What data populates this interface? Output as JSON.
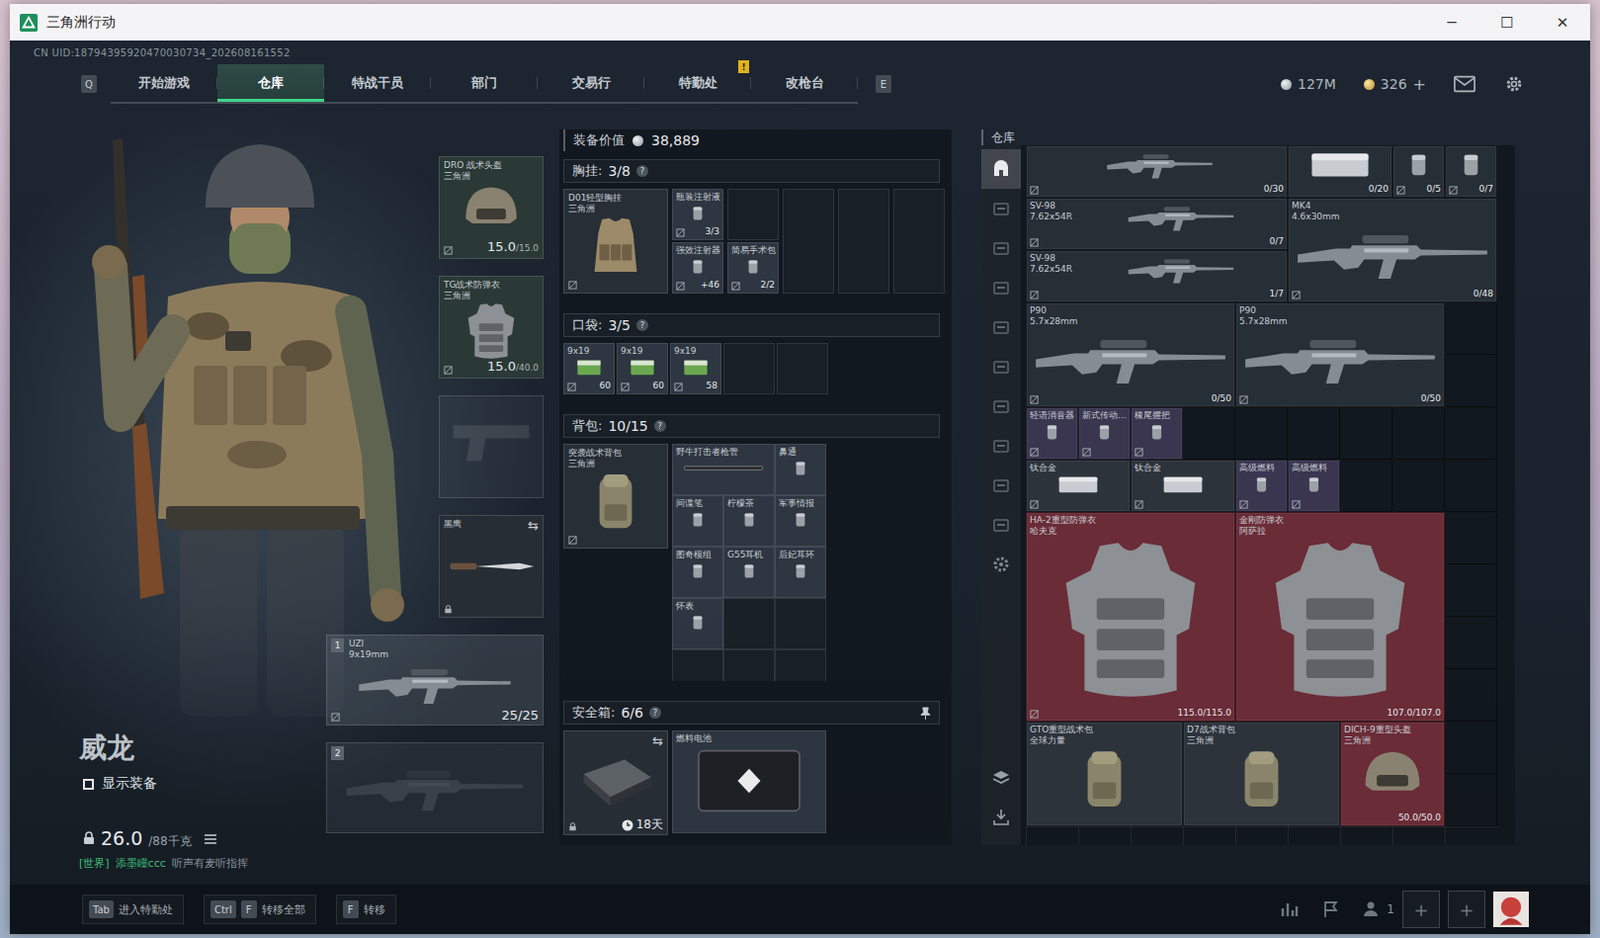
{
  "window": {
    "title": "三角洲行动",
    "controls": [
      "─",
      "☐",
      "✕"
    ]
  },
  "uid": "CN UID:18794395920470030734_202608161552",
  "nav": {
    "prev_key": "Q",
    "next_key": "E",
    "tabs": [
      {
        "label": "开始游戏",
        "selected": false
      },
      {
        "label": "仓库",
        "selected": true
      },
      {
        "label": "特战干员",
        "selected": false
      },
      {
        "label": "部门",
        "selected": false
      },
      {
        "label": "交易行",
        "selected": false
      },
      {
        "label": "特勤处",
        "selected": false,
        "badge": "!"
      },
      {
        "label": "改枪台",
        "selected": false
      }
    ]
  },
  "currency": [
    {
      "kind": "silver",
      "amount": "127M"
    },
    {
      "kind": "gold",
      "amount": "326",
      "add": "+"
    }
  ],
  "operator": {
    "name": "威龙",
    "show_gear": {
      "label": "显示装备",
      "checked": false
    },
    "weight": {
      "value": "26.0",
      "max": "/88千克"
    },
    "chat": {
      "channel": "[世界]",
      "user": "添墨瞳ccc",
      "text": "听声有麦听指挥"
    }
  },
  "equipment": [
    {
      "kind": "helmet",
      "filled": true,
      "name": "DRO 战术头盔",
      "sub": "三角洲",
      "reading": "15.0",
      "max": "/15.0",
      "marked": true,
      "color": "#2a3936"
    },
    {
      "kind": "armor",
      "filled": true,
      "name": "TG战术防弹衣",
      "sub": "三角洲",
      "reading": "15.0",
      "max": "/40.0",
      "marked": true,
      "color": "#2a3936"
    },
    {
      "kind": "pistol",
      "filled": false
    },
    {
      "kind": "melee",
      "filled": true,
      "name": "黑鹰",
      "swap": "⇆",
      "locked": true,
      "color": "#262d34"
    }
  ],
  "weapons": [
    {
      "slot": "1",
      "kind": "gun",
      "filled": true,
      "name": "UZI",
      "sub": "9x19mm",
      "ammo": "25/25",
      "marked": true
    },
    {
      "slot": "2",
      "kind": "gun",
      "filled": false
    }
  ],
  "loadout": {
    "value_label": "装备价值",
    "value": "38,889",
    "sections": [
      {
        "kind": "chest",
        "title": "胸挂:",
        "count": "3/8",
        "help": "?",
        "pinned": false,
        "container": {
          "kind": "rig",
          "name": "D01轻型胸挂",
          "sub": "三角洲",
          "marked": true
        },
        "items": [
          {
            "kind": "item",
            "name": "瓶装注射液",
            "count": "3/3",
            "marked": true
          },
          {
            "kind": "item",
            "name": "强效注射器",
            "count": "+46",
            "marked": true
          },
          {
            "kind": "empty"
          },
          {
            "kind": "item",
            "name": "简易手术包",
            "count": "2/2",
            "marked": true
          },
          {
            "kind": "tall"
          },
          {
            "kind": "tall"
          },
          {
            "kind": "tall"
          }
        ]
      },
      {
        "kind": "pockets",
        "title": "口袋:",
        "count": "3/5",
        "help": "?",
        "pinned": false,
        "items": [
          {
            "kind": "ammo",
            "name": "9x19",
            "count": "60",
            "marked": true
          },
          {
            "kind": "ammo",
            "name": "9x19",
            "count": "60",
            "marked": true
          },
          {
            "kind": "ammo",
            "name": "9x19",
            "count": "58",
            "marked": true
          },
          {
            "kind": "empty"
          },
          {
            "kind": "empty"
          }
        ]
      },
      {
        "kind": "backpack",
        "title": "背包:",
        "count": "10/15",
        "help": "?",
        "pinned": false,
        "container": {
          "kind": "pack",
          "name": "突袭战术背包",
          "sub": "三角洲",
          "marked": true
        },
        "items": [
          {
            "kind": "rod",
            "name": "野牛打击者枪管"
          },
          {
            "kind": "item",
            "name": "鼻通"
          },
          {
            "kind": "item",
            "name": "间谍笔"
          },
          {
            "kind": "item",
            "name": "柠檬茶"
          },
          {
            "kind": "item",
            "name": "军事情报"
          },
          {
            "kind": "item",
            "name": "图奇模组"
          },
          {
            "kind": "item",
            "name": "G55耳机"
          },
          {
            "kind": "item",
            "name": "后妃耳环"
          },
          {
            "kind": "item",
            "name": "怀表"
          },
          {
            "kind": "empty"
          },
          {
            "kind": "empty"
          },
          {
            "kind": "empty"
          },
          {
            "kind": "empty"
          },
          {
            "kind": "empty"
          }
        ]
      },
      {
        "kind": "secure",
        "title": "安全箱:",
        "count": "6/6",
        "help": "?",
        "pinned": true,
        "container": {
          "kind": "safe",
          "timer": "18天",
          "swap": "⇆",
          "locked": true
        },
        "items": [
          {
            "kind": "case",
            "name": "燃料电池"
          }
        ]
      }
    ]
  },
  "warehouse": {
    "title": "仓库",
    "sidebar": [
      {
        "kind": "home",
        "selected": true
      },
      {
        "kind": "tab",
        "selected": false
      },
      {
        "kind": "tab",
        "selected": false
      },
      {
        "kind": "tab",
        "selected": false
      },
      {
        "kind": "tab",
        "selected": false
      },
      {
        "kind": "tab",
        "selected": false
      },
      {
        "kind": "tab",
        "selected": false
      },
      {
        "kind": "tab",
        "selected": false
      },
      {
        "kind": "tab",
        "selected": false
      },
      {
        "kind": "tab",
        "selected": false
      },
      {
        "kind": "settings",
        "selected": false
      }
    ],
    "tools": [
      {
        "kind": "layers"
      },
      {
        "kind": "sort"
      }
    ],
    "items": [
      {
        "kind": "long",
        "count": "0/30",
        "marked": true,
        "color": "#262e36"
      },
      {
        "kind": "double",
        "count": "0/20",
        "marked": false,
        "color": "#262e36"
      },
      {
        "kind": "single",
        "count": "0/5",
        "marked": true,
        "color": "#262e36"
      },
      {
        "kind": "single",
        "count": "0/7",
        "marked": true,
        "color": "#262e36"
      },
      {
        "kind": "long",
        "name": "SV-98",
        "sub": "7.62x54R",
        "count": "0/7",
        "marked": true,
        "color": "#262e36"
      },
      {
        "kind": "wide",
        "name": "MK4",
        "sub": "4.6x30mm",
        "count": "0/48",
        "marked": true,
        "color": "#262e36"
      },
      {
        "kind": "long",
        "name": "SV-98",
        "sub": "7.62x54R",
        "count": "1/7",
        "marked": true,
        "color": "#262e36"
      },
      {
        "kind": "wide",
        "name": "P90",
        "sub": "5.7x28mm",
        "count": "0/50",
        "marked": true,
        "color": "#262e36"
      },
      {
        "kind": "wide",
        "name": "P90",
        "sub": "5.7x28mm",
        "count": "0/50",
        "marked": true,
        "color": "#262e36"
      },
      {
        "kind": "empty"
      },
      {
        "kind": "empty"
      },
      {
        "kind": "single",
        "name": "轻语消音器",
        "marked": true,
        "color": "#3a3650"
      },
      {
        "kind": "single",
        "name": "新式传动…",
        "marked": true,
        "color": "#3a3650"
      },
      {
        "kind": "single",
        "name": "橡尾握把",
        "marked": true,
        "color": "#3a3650"
      },
      {
        "kind": "empty"
      },
      {
        "kind": "empty"
      },
      {
        "kind": "empty"
      },
      {
        "kind": "empty"
      },
      {
        "kind": "empty"
      },
      {
        "kind": "empty"
      },
      {
        "kind": "double",
        "name": "钛合金",
        "marked": true,
        "color": "#2c333b"
      },
      {
        "kind": "double",
        "name": "钛合金",
        "marked": true,
        "color": "#2c333b"
      },
      {
        "kind": "single",
        "name": "高级燃料",
        "marked": true,
        "color": "#3a3650"
      },
      {
        "kind": "single",
        "name": "高级燃料",
        "marked": true,
        "color": "#3a3650"
      },
      {
        "kind": "empty"
      },
      {
        "kind": "empty"
      },
      {
        "kind": "empty"
      },
      {
        "kind": "armor",
        "name": "HA-2重型防弹衣",
        "sub": "哈夫克",
        "count": "115.0/115.0",
        "marked": true,
        "color": "#6a2c37"
      },
      {
        "kind": "armor",
        "name": "金刚防弹衣",
        "sub": "阿萨拉",
        "count": "107.0/107.0",
        "marked": false,
        "color": "#6a2c37"
      },
      {
        "kind": "empty"
      },
      {
        "kind": "empty"
      },
      {
        "kind": "empty"
      },
      {
        "kind": "empty"
      },
      {
        "kind": "bag",
        "name": "GTO重型战术包",
        "sub": "全球力量",
        "marked": false,
        "color": "#2c333b"
      },
      {
        "kind": "bag",
        "name": "D7战术背包",
        "sub": "三角洲",
        "marked": false,
        "color": "#2c333b"
      },
      {
        "kind": "helmet",
        "name": "DICH-9重型头盔",
        "sub": "三角洲",
        "count": "50.0/50.0",
        "marked": false,
        "color": "#6a2c37"
      },
      {
        "kind": "empty"
      },
      {
        "kind": "empty"
      }
    ]
  },
  "hints": [
    {
      "keys": [
        "Tab"
      ],
      "label": "进入特勤处"
    },
    {
      "keys": [
        "Ctrl",
        "F"
      ],
      "label": "转移全部"
    },
    {
      "keys": [
        "F"
      ],
      "label": "转移"
    }
  ],
  "social": {
    "party": "1",
    "slots": [
      "+",
      "+"
    ]
  }
}
